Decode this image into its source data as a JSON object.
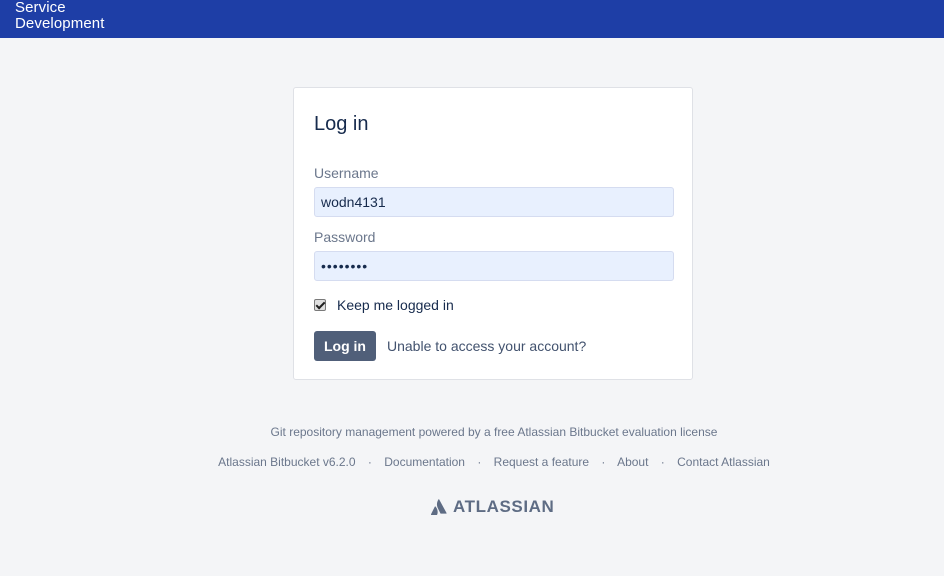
{
  "header": {
    "brand_line1": "Service",
    "brand_line2": "Development"
  },
  "login": {
    "title": "Log in",
    "username_label": "Username",
    "username_value": "wodn4131",
    "password_label": "Password",
    "password_value": "••••••••",
    "remember_label": "Keep me logged in",
    "remember_checked": true,
    "submit_label": "Log in",
    "help_link": "Unable to access your account?"
  },
  "footer": {
    "license": "Git repository management powered by a free Atlassian Bitbucket evaluation license",
    "links": {
      "version": "Atlassian Bitbucket v6.2.0",
      "documentation": "Documentation",
      "request_feature": "Request a feature",
      "about": "About",
      "contact": "Contact Atlassian"
    },
    "separator": "·",
    "logo_text": "ATLASSIAN"
  },
  "colors": {
    "header_bg": "#1e3ea6",
    "page_bg": "#f4f5f7",
    "button_bg": "#505f79",
    "autofill_bg": "#e8f0fe"
  }
}
